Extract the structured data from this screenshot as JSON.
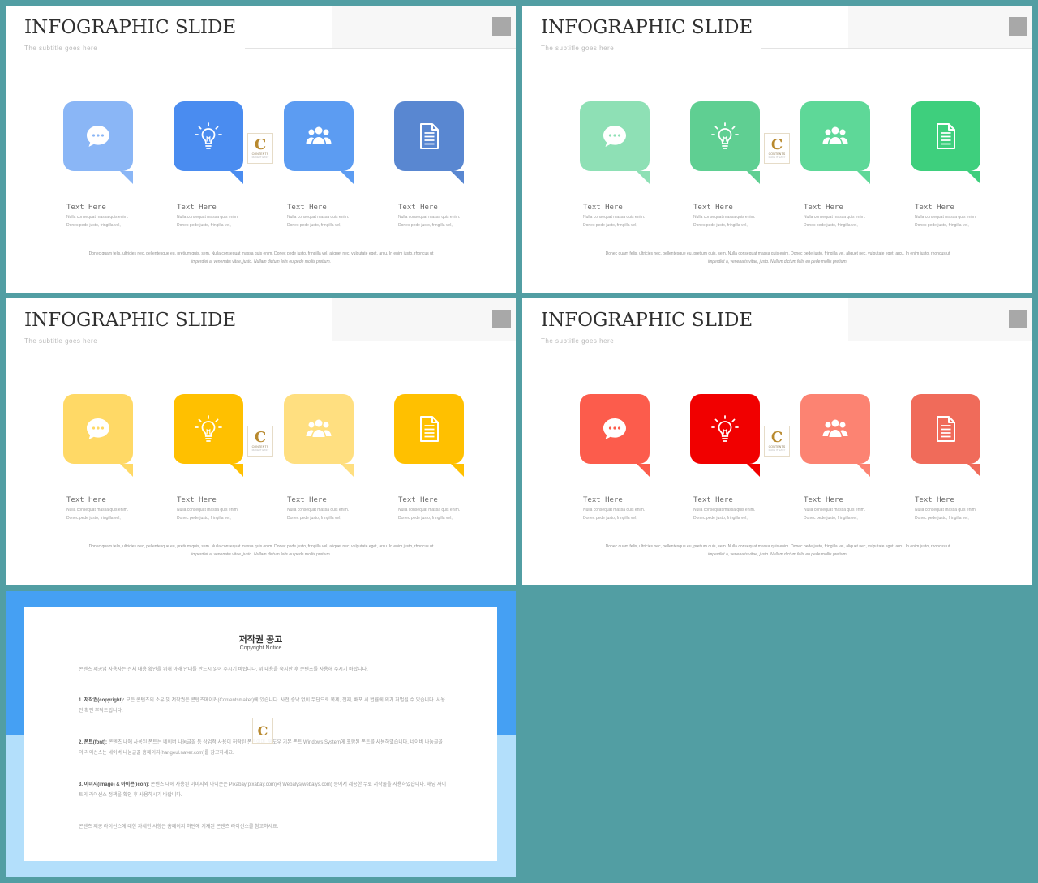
{
  "slides": [
    {
      "title": "INFOGRAPHIC SLIDE",
      "subtitle": "The  subtitle  goes  here",
      "colors": [
        "#8ab6f6",
        "#4a8cf0",
        "#5c9cf2",
        "#5987d1"
      ],
      "columns": [
        {
          "icon": "chat-bubble-icon",
          "heading": "Text  Here",
          "line1": "Nulla consequat massa quis enim.",
          "line2": "Donec pede justo, fringilla vel,"
        },
        {
          "icon": "lightbulb-icon",
          "heading": "Text  Here",
          "line1": "Nulla consequat massa quis enim.",
          "line2": "Donec pede justo, fringilla vel,"
        },
        {
          "icon": "people-group-icon",
          "heading": "Text  Here",
          "line1": "Nulla consequat massa quis enim.",
          "line2": "Donec pede justo, fringilla vel,"
        },
        {
          "icon": "document-icon",
          "heading": "Text  Here",
          "line1": "Nulla consequat massa quis enim.",
          "line2": "Donec pede justo, fringilla vel,"
        }
      ],
      "footer1": "Donec quam felis, ultricies nec, pellentesque eu, pretium quis, sem. Nulla consequat massa quis enim. Donec pede justo, fringilla vel, aliquet nec, vulputate eget, arcu. In enim justo, rhoncus ut",
      "footer2": "imperdiet a, venenatis vitae, justo. Nullam dictum felis eu pede mollis pretium."
    },
    {
      "title": "INFOGRAPHIC SLIDE",
      "subtitle": "The  subtitle  goes  here",
      "colors": [
        "#8ee0b5",
        "#5fcf92",
        "#5ed898",
        "#3ecf7d"
      ],
      "columns": [
        {
          "icon": "chat-bubble-icon",
          "heading": "Text  Here",
          "line1": "Nulla consequat massa quis enim.",
          "line2": "Donec pede justo, fringilla vel,"
        },
        {
          "icon": "lightbulb-icon",
          "heading": "Text  Here",
          "line1": "Nulla consequat massa quis enim.",
          "line2": "Donec pede justo, fringilla vel,"
        },
        {
          "icon": "people-group-icon",
          "heading": "Text  Here",
          "line1": "Nulla consequat massa quis enim.",
          "line2": "Donec pede justo, fringilla vel,"
        },
        {
          "icon": "document-icon",
          "heading": "Text  Here",
          "line1": "Nulla consequat massa quis enim.",
          "line2": "Donec pede justo, fringilla vel,"
        }
      ],
      "footer1": "Donec quam felis, ultricies nec, pellentesque eu, pretium quis, sem. Nulla consequat massa quis enim. Donec pede justo, fringilla vel, aliquet nec, vulputate eget, arcu. In enim justo, rhoncus ut",
      "footer2": "imperdiet a, venenatis vitae, justo. Nullam dictum felis eu pede mollis pretium."
    },
    {
      "title": "INFOGRAPHIC SLIDE",
      "subtitle": "The  subtitle  goes  here",
      "colors": [
        "#ffd966",
        "#ffc000",
        "#ffdf80",
        "#ffc000"
      ],
      "columns": [
        {
          "icon": "chat-bubble-icon",
          "heading": "Text  Here",
          "line1": "Nulla consequat massa quis enim.",
          "line2": "Donec pede justo, fringilla vel,"
        },
        {
          "icon": "lightbulb-icon",
          "heading": "Text  Here",
          "line1": "Nulla consequat massa quis enim.",
          "line2": "Donec pede justo, fringilla vel,"
        },
        {
          "icon": "people-group-icon",
          "heading": "Text  Here",
          "line1": "Nulla consequat massa quis enim.",
          "line2": "Donec pede justo, fringilla vel,"
        },
        {
          "icon": "document-icon",
          "heading": "Text  Here",
          "line1": "Nulla consequat massa quis enim.",
          "line2": "Donec pede justo, fringilla vel,"
        }
      ],
      "footer1": "Donec quam felis, ultricies nec, pellentesque eu, pretium quis, sem. Nulla consequat massa quis enim. Donec pede justo, fringilla vel, aliquet nec, vulputate eget, arcu. In enim justo, rhoncus ut",
      "footer2": "imperdiet a, venenatis vitae, justo. Nullam dictum felis eu pede mollis pretium."
    },
    {
      "title": "INFOGRAPHIC SLIDE",
      "subtitle": "The  subtitle  goes  here",
      "colors": [
        "#fc5c4c",
        "#f10000",
        "#fc8372",
        "#f06b5a"
      ],
      "columns": [
        {
          "icon": "chat-bubble-icon",
          "heading": "Text  Here",
          "line1": "Nulla consequat massa quis enim.",
          "line2": "Donec pede justo, fringilla vel,"
        },
        {
          "icon": "lightbulb-icon",
          "heading": "Text  Here",
          "line1": "Nulla consequat massa quis enim.",
          "line2": "Donec pede justo, fringilla vel,"
        },
        {
          "icon": "people-group-icon",
          "heading": "Text  Here",
          "line1": "Nulla consequat massa quis enim.",
          "line2": "Donec pede justo, fringilla vel,"
        },
        {
          "icon": "document-icon",
          "heading": "Text  Here",
          "line1": "Nulla consequat massa quis enim.",
          "line2": "Donec pede justo, fringilla vel,"
        }
      ],
      "footer1": "Donec quam felis, ultricies nec, pellentesque eu, pretium quis, sem. Nulla consequat massa quis enim. Donec pede justo, fringilla vel, aliquet nec, vulputate eget, arcu. In enim justo, rhoncus ut",
      "footer2": "imperdiet a, venenatis vitae, justo. Nullam dictum felis eu pede mollis pretium."
    }
  ],
  "logo": {
    "letter": "C",
    "text": "CONTENTS",
    "sub": "MAKE IT EASY"
  },
  "copyright": {
    "title": "저작권 공고",
    "subtitle": "Copyright Notice",
    "intro": "콘텐츠 제공업 사용자는 전체 내용 확인을 위해 아래 안내를 반드시 읽어 주시기 바랍니다. 위 내용을 숙지한 후 콘텐츠를 사용해 주시기 바랍니다.",
    "p1_head": "1. 저작권(copyright):",
    "p1_body": "모든 콘텐츠의 소유 및 저작권은 콘텐츠메이커(Contentsmaker)에 있습니다. 사전 승낙 없이 무단으로 복제, 전재, 배포 시 법률에 의거 처벌될 수 있습니다. 사용 전 확인 부탁드립니다.",
    "p2_head": "2. 폰트(font):",
    "p2_body": "콘텐츠 내에 사용된 폰트는 네이버 나눔글꼴 등 상업적 사용이 허락된 폰트이며, 윈도우 기본 폰트 Windows System에 포함된 폰트를 사용하였습니다. 네이버 나눔글꼴의 라이선스는 네이버 나눔글꼴 홈페이지(hangeul.naver.com)를 참고하세요.",
    "p3_head": "3. 이미지(image) & 아이콘(icon):",
    "p3_body": "콘텐츠 내에 사용된 이미지와 아이콘은 Pixabay(pixabay.com)와 Webalys(webalys.com) 등에서 제공한 무료 저작물을 사용하였습니다. 해당 사이트의 라이선스 정책을 확인 후 사용하시기 바랍니다.",
    "outro": "콘텐츠 제공 라이선스에 대한 자세한 사항은 홈페이지 하단에 기재된 콘텐츠 라이선스를 참고하세요."
  }
}
